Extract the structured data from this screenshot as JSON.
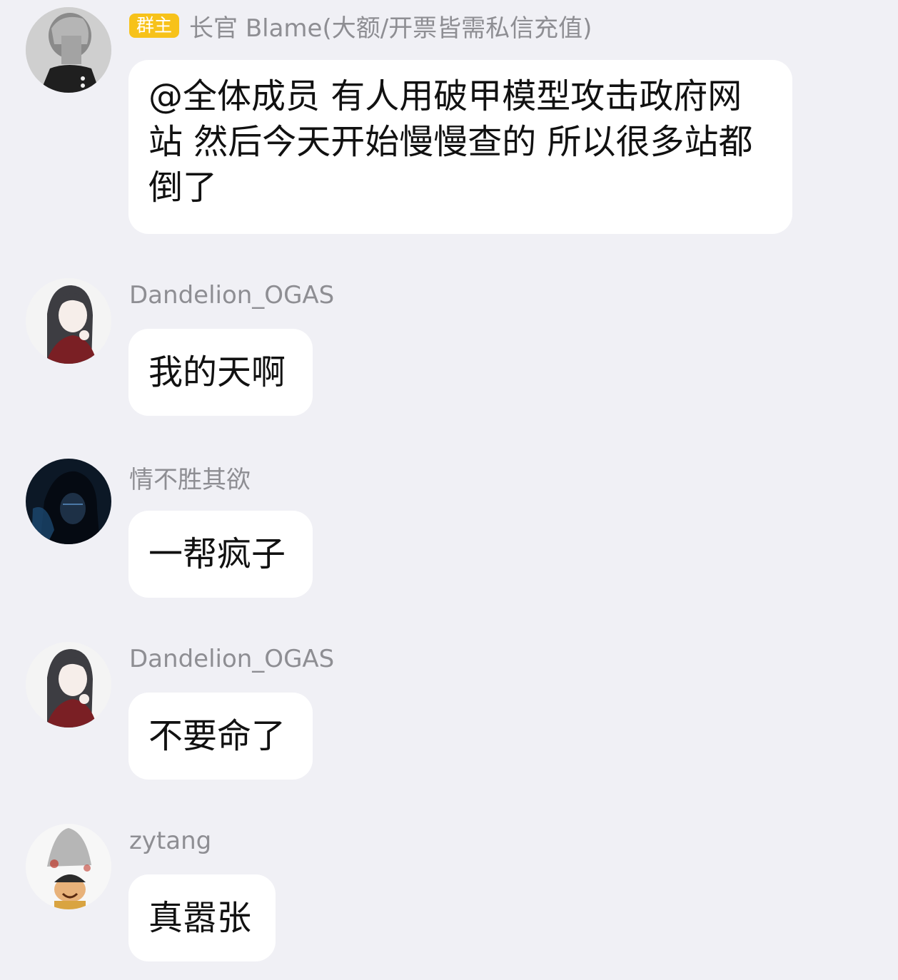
{
  "messages": [
    {
      "badge": "群主",
      "sender": "长官 Blame(大额/开票皆需私信充值)",
      "text": "@全体成员 有人用破甲模型攻击政府网站 然后今天开始慢慢查的 所以很多站都倒了",
      "avatar": "portrait-avatar"
    },
    {
      "sender": "Dandelion_OGAS",
      "text": "我的天啊",
      "avatar": "anime-girl-avatar"
    },
    {
      "sender": "情不胜其欲",
      "text": "一帮疯子",
      "avatar": "dark-hooded-avatar"
    },
    {
      "sender": "Dandelion_OGAS",
      "text": "不要命了",
      "avatar": "anime-girl-avatar"
    },
    {
      "sender": "zytang",
      "text": "真嚣张",
      "avatar": "cartoon-avatar"
    }
  ],
  "colors": {
    "background": "#f0f0f5",
    "bubble": "#ffffff",
    "sender_text": "#8e8e93",
    "badge": "#f7c21a",
    "message_text": "#111111"
  }
}
